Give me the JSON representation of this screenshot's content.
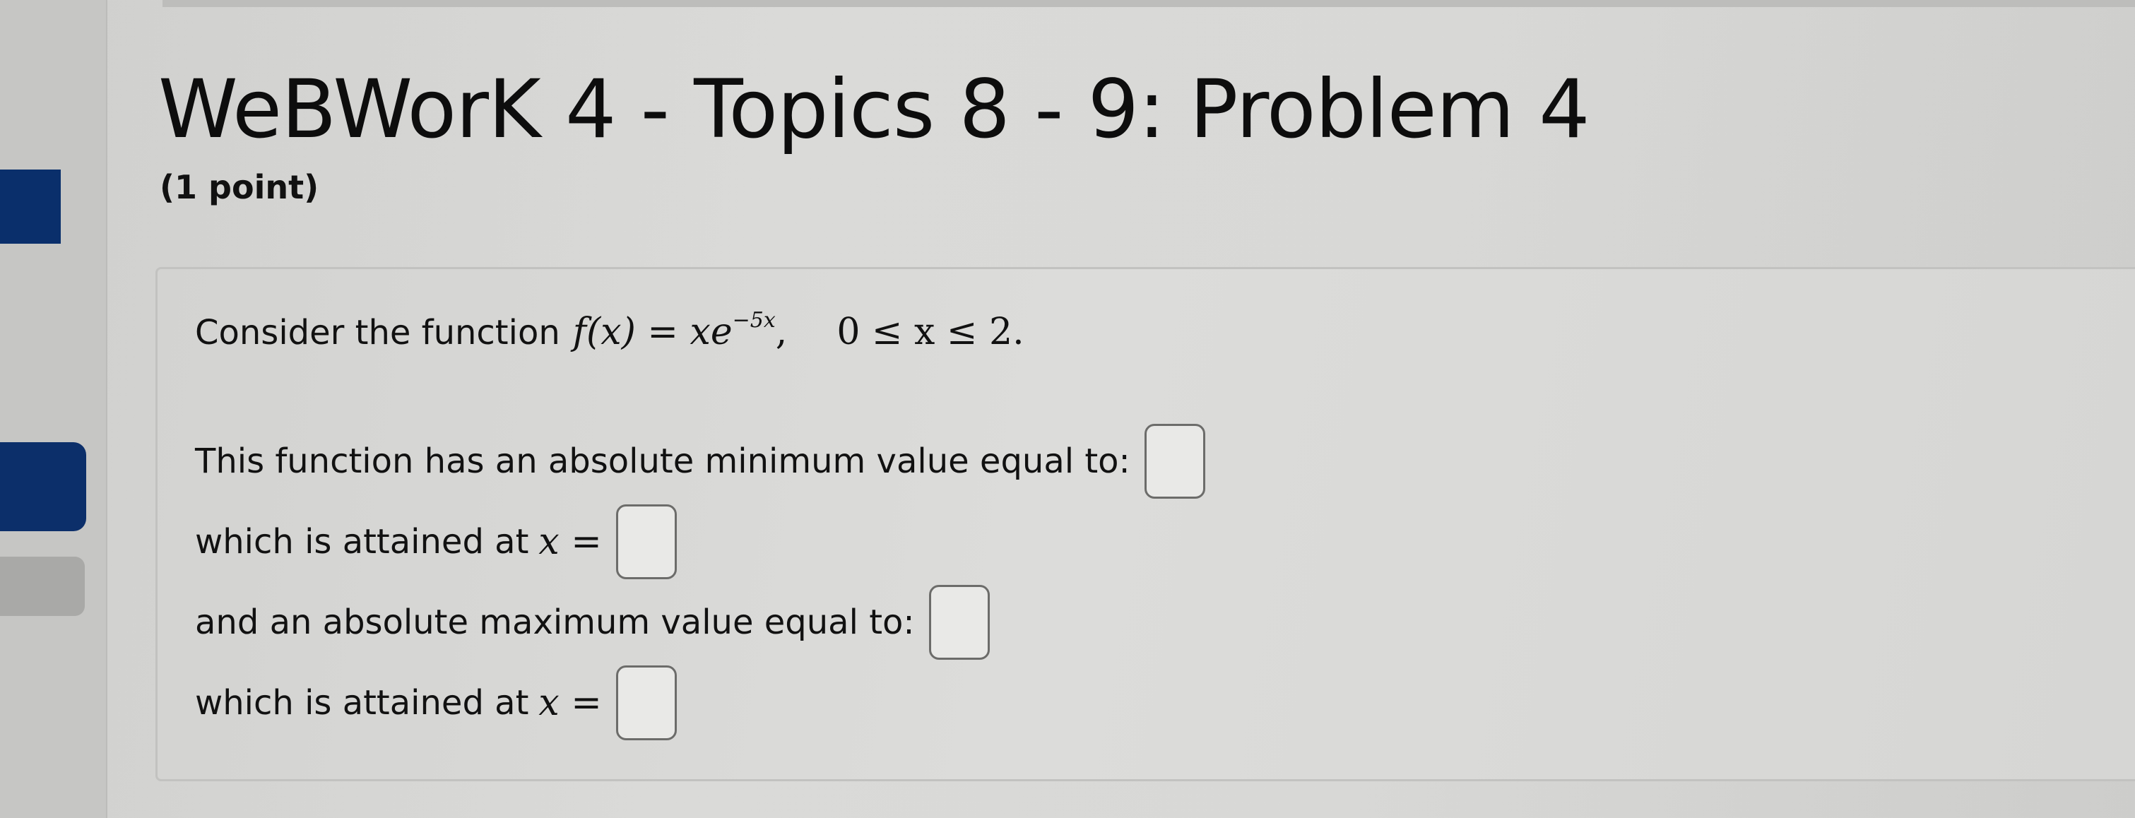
{
  "header": {
    "title": "WeBWorK 4 - Topics 8 - 9: Problem 4",
    "points": "(1 point)"
  },
  "problem": {
    "intro_text": "Consider the function",
    "function_lhs": "f(x) = xe",
    "function_exponent": "−5x",
    "function_sep": ",",
    "domain": "0 ≤ x ≤ 2.",
    "questions": [
      {
        "label": "This function has an absolute minimum value equal to:",
        "math": ""
      },
      {
        "label": "which is attained at",
        "math": "x ="
      },
      {
        "label": "and an absolute maximum value equal to:",
        "math": ""
      },
      {
        "label": "which is attained at",
        "math": "x ="
      }
    ],
    "answers": [
      "",
      "",
      "",
      ""
    ]
  },
  "colors": {
    "sidebar_accent": "#0a2f6b",
    "text": "#111111"
  }
}
